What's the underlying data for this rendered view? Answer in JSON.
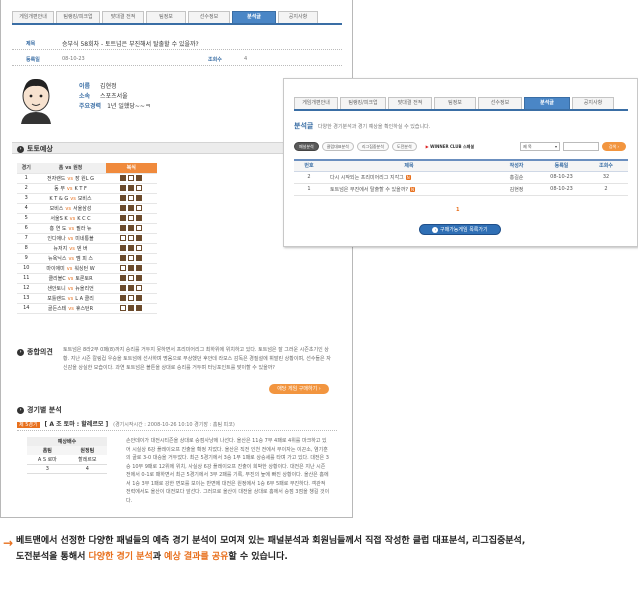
{
  "back": {
    "tabs": [
      "게임개편안내",
      "팀랭킹/피크업",
      "맞대결 전적",
      "팀정보",
      "선수정보",
      "분석글",
      "공지사항"
    ],
    "active_tab": 5,
    "post": {
      "title_label": "제목",
      "title": "승부식 58회차 - 토트넘은 부진해서 탈출할 수 있을까?",
      "date_label": "등록일",
      "date": "08-10-23",
      "views_label": "조회수",
      "views": "4"
    },
    "profile": {
      "name_label": "이름",
      "name": "김현정",
      "affil_label": "소속",
      "affil": "스포츠서울",
      "career_label": "주요경력",
      "career": "1년 일했당~~ㅋ"
    },
    "prediction": {
      "section_title": "토토예상",
      "headers": [
        "경기",
        "홈 vs 원정",
        "복식"
      ],
      "rows": [
        {
          "n": "1",
          "home": "전자랜드",
          "away": "장 원L G",
          "picks": [
            1,
            0,
            1
          ]
        },
        {
          "n": "2",
          "home": "동 부",
          "away": "K T F",
          "picks": [
            1,
            1,
            0
          ]
        },
        {
          "n": "3",
          "home": "K T & G",
          "away": "모비스",
          "picks": [
            1,
            0,
            1
          ]
        },
        {
          "n": "4",
          "home": "모비스",
          "away": "서울삼성",
          "picks": [
            1,
            1,
            0
          ]
        },
        {
          "n": "5",
          "home": "서울S K",
          "away": "K C C",
          "picks": [
            1,
            0,
            1
          ]
        },
        {
          "n": "6",
          "home": "흥 연 도",
          "away": "필라 뉴",
          "picks": [
            1,
            1,
            0
          ]
        },
        {
          "n": "7",
          "home": "인디애나",
          "away": "미네통블",
          "picks": [
            0,
            0,
            1
          ]
        },
        {
          "n": "8",
          "home": "뉴저지",
          "away": "덴 버",
          "picks": [
            1,
            1,
            0
          ]
        },
        {
          "n": "9",
          "home": "뉴욕닉스",
          "away": "멤 피 스",
          "picks": [
            1,
            0,
            1
          ]
        },
        {
          "n": "10",
          "home": "마이애미",
          "away": "워싱턴 W",
          "picks": [
            0,
            1,
            1
          ]
        },
        {
          "n": "11",
          "home": "클리블C",
          "away": "토론토R",
          "picks": [
            1,
            0,
            1
          ]
        },
        {
          "n": "12",
          "home": "샌안토니",
          "away": "뉴올리언",
          "picks": [
            1,
            1,
            0
          ]
        },
        {
          "n": "13",
          "home": "포틀랜드",
          "away": "L A 클리",
          "picks": [
            1,
            0,
            1
          ]
        },
        {
          "n": "14",
          "home": "골든스테",
          "away": "휴스턴R",
          "picks": [
            0,
            1,
            1
          ]
        }
      ],
      "vs": "vs"
    },
    "opinion": {
      "section_title": "종합의견",
      "text": "토트넘은 8라2무 0패(8)까지 승리를 거두지 못하면서 프리미어리그 최하위에 위치하고 있다. 토트넘은 잘 그러운 시즌초기인 상황. 지난 시즌 칼링컵 우승을 토트넘에 선사하며 명움으로 부상했던 후안데 라모스 감독은 경질설에 휘말린 상황이며, 선수들은 자신감을 상실한 모습이다. 과연 토트넘은 볼튼을 상대로 승리를 거두며 터닝포인트를 맞이할 수 있을까?",
      "button": "애당 게임 구매하기 ›"
    },
    "analysis": {
      "section_title": "경기별 분석",
      "match_tag": "제 5경기",
      "match_title": "[ A 조 토마 : 할레르모 ]",
      "match_meta": "(경기시작시간 : 2008-10-26 10:10 경기장 : 홈팀 피코)",
      "table_title": "예상배수",
      "table_headers": [
        "홈팀",
        "원정팀"
      ],
      "table_row1": [
        "A S 로마",
        "할레르모"
      ],
      "table_row2": [
        "3",
        "4"
      ],
      "text": "손안데이가 대전시티즌을 상대로 승점사냥에 나선다. 올산은 11승 7무 4패로 4위를 마크하고 있어 시실상 6강 플레이오프 진출을 확정 지었다. 올산은 직전 인천 전에서 무이자는 이끈소, 염기훈의 골로 3-0 대승을 거두었다. 최근 5경기에서 3승 1무 1패로 상승세를 타며 가고 있다. 대전은 3승 10무 9패로 12위에 위치, 사실상 6강 플레이오프 진출이 희박한 상황이다. 대전은 지난 시즌 전에서 0-1로 패하면서 최근 5경기에서 3무 2패를 기록, 무진의 늪에 빠진 상황이다. 올산은 홈에서 1승 3무 1패로 강한 면모를 보이는 반면에 대전은 원정에서 1승 6무 5패로 부진하다. 객관적 전력에서도 올산이 대전보다 앞선다. 그러므로 올산이 대전을 상대로 홈에서 승점 3점을 챙길 것이다."
    }
  },
  "front": {
    "tabs": [
      "게임개편안내",
      "팀랭킹/피크업",
      "맞대결 전적",
      "팀정보",
      "선수정보",
      "분석글",
      "공지사항"
    ],
    "active_tab": 5,
    "heading": "분석글",
    "heading_desc": "다양한 경기분석과 경기 예상을 확인하실 수 있습니다.",
    "filters": [
      "패널분석",
      "클럽대표분석",
      "리그집중분석",
      "도전분석"
    ],
    "club_label": "WINNER CLUB 스페셜",
    "search_select": "제 목",
    "search_button": "검색 ›",
    "table_headers": [
      "번호",
      "제목",
      "작성자",
      "등록일",
      "조회수"
    ],
    "rows": [
      {
        "no": "2",
        "title": "다시 시작되는 프리미어리그 지각그",
        "author": "홍길순",
        "date": "08-10-23",
        "views": "32"
      },
      {
        "no": "1",
        "title": "토트넘은 부진에서 탈출할 수 있을까?",
        "author": "김현정",
        "date": "08-10-23",
        "views": "2"
      }
    ],
    "new_badge": "N",
    "page": "1",
    "buy_button": "구매가능게임 목록가기"
  },
  "caption": {
    "line1": "베트맨에서 선정한 다양한 패널들의 예측 경기 분석이 모여져 있는 패널분석과 회원님들께서 직접 작성한 클럽 대표분석, 리그집중분석,",
    "line2_pre": "도전분석을 통해서 ",
    "line2_hl1": "다양한 경기 분석",
    "line2_mid": "과 ",
    "line2_hl2": "예상 결과를 공유",
    "line2_post": "할 수 있습니다."
  },
  "colors": {
    "accent": "#3a6ea5",
    "orange": "#e8701d",
    "pick": "#6b4a2b"
  },
  "icons": [
    "avatar",
    "arrow-right-icon",
    "search-icon"
  ]
}
